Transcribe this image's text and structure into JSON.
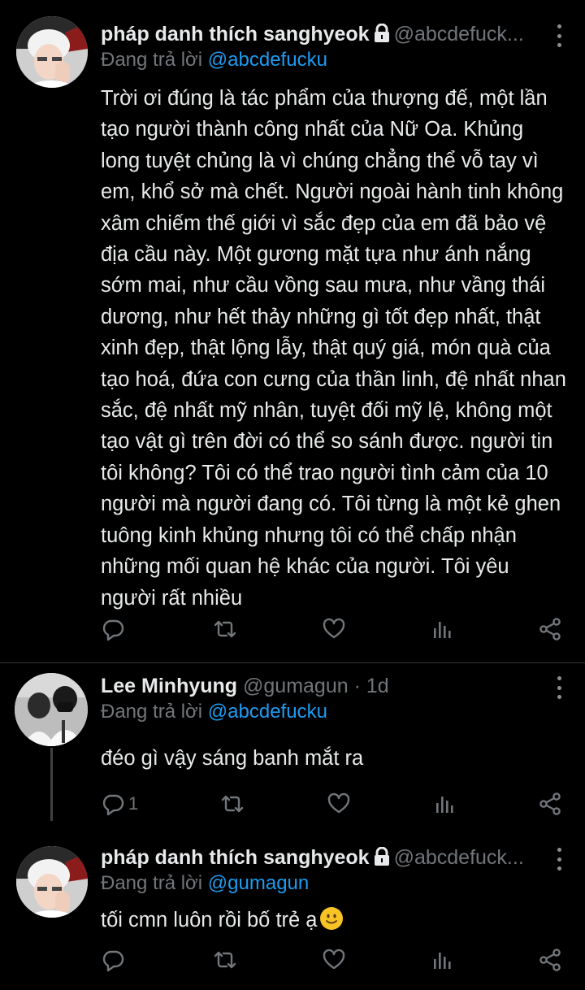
{
  "tweets": [
    {
      "name": "pháp danh thích sanghyeok",
      "handle": "@abcdefuck...",
      "reply_label": "Đang trả lời",
      "reply_to": "@abcdefucku",
      "text": "Trời ơi đúng là tác phẩm của thượng đế, một lần tạo người thành công nhất của Nữ Oa. Khủng long tuyệt chủng là vì chúng chẳng thể vỗ tay vì em, khổ sở mà chết. Người ngoài hành tinh không xâm chiếm thế giới vì sắc đẹp của em đã bảo vệ địa cầu này. Một gương mặt tựa như ánh nắng sớm mai, như cầu vồng sau mưa, như vầng thái dương, như hết thảy những gì tốt đẹp nhất, thật xinh đẹp, thật lộng lẫy, thật quý giá, món quà của tạo hoá, đứa con cưng của thần linh, đệ nhất nhan sắc, đệ nhất mỹ nhân, tuyệt đối mỹ lệ, không một tạo vật gì trên đời có thể so sánh được. người tin tôi không? Tôi có thể trao người tình cảm của 10 người mà người đang có. Tôi từng là một kẻ ghen tuông kinh khủng nhưng tôi có thể chấp nhận những mối quan hệ khác của người. Tôi yêu người rất nhiều",
      "reply_count": ""
    },
    {
      "name": "Lee Minhyung",
      "handle": "@gumagun · 1d",
      "reply_label": "Đang trả lời",
      "reply_to": "@abcdefucku",
      "text": "đéo gì vậy sáng banh mắt ra",
      "reply_count": "1"
    },
    {
      "name": "pháp danh thích sanghyeok",
      "handle": "@abcdefuck...",
      "reply_label": "Đang trả lời",
      "reply_to": "@gumagun",
      "text": "tối cmn luôn rồi bố trẻ ạ",
      "reply_count": ""
    }
  ],
  "icons": {
    "reply": "reply-icon",
    "retweet": "retweet-icon",
    "like": "heart-icon",
    "views": "analytics-icon",
    "share": "share-icon",
    "more": "more-vertical-icon",
    "lock": "lock-icon",
    "emoji": "slightly-smiling-face-emoji"
  },
  "colors": {
    "background": "#000000",
    "text": "#e7e9ea",
    "secondary": "#71767b",
    "link": "#1d9bf0",
    "divider": "#2f3336"
  }
}
